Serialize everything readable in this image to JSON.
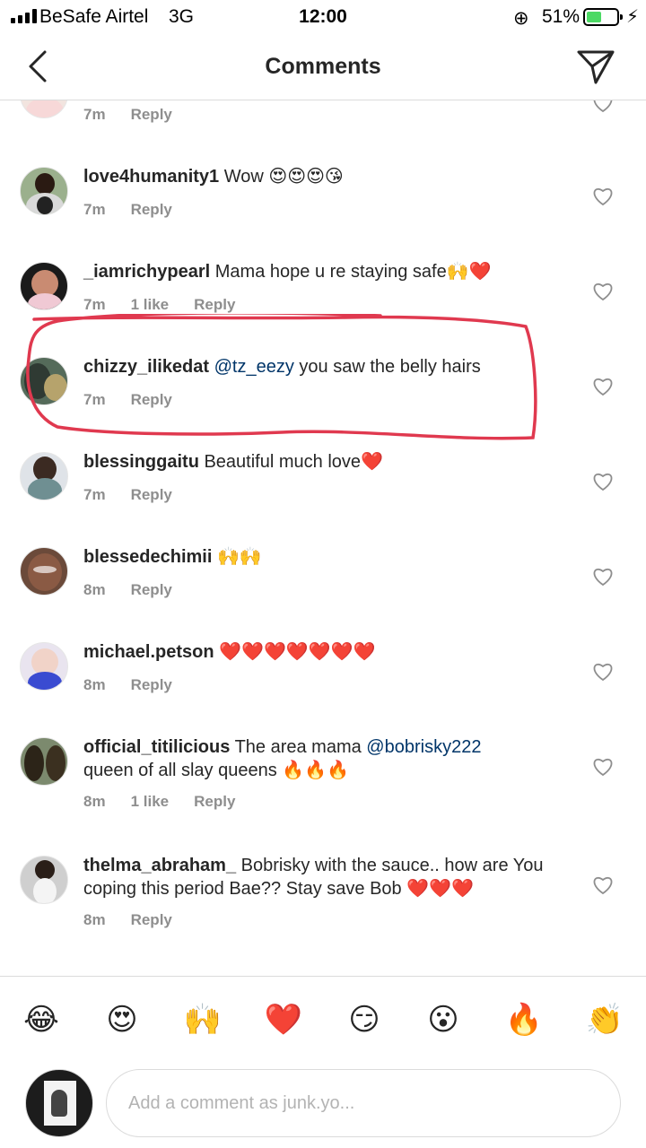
{
  "status_bar": {
    "carrier": "BeSafe Airtel",
    "network": "3G",
    "time": "12:00",
    "battery_percent": "51%",
    "battery_level": 0.51,
    "rotation_lock_icon": "⊕",
    "charging_icon": "⚡"
  },
  "header": {
    "title": "Comments",
    "back_icon": "chevron-left",
    "send_icon": "paper-plane"
  },
  "comments": [
    {
      "username": "",
      "text": "",
      "time": "7m",
      "likes": "",
      "reply": "Reply"
    },
    {
      "username": "love4humanity1",
      "text": "Wow 😍😍😍😘",
      "time": "7m",
      "likes": "",
      "reply": "Reply"
    },
    {
      "username": "_iamrichypearl",
      "text": "Mama hope u re staying safe🙌❤️",
      "time": "7m",
      "likes": "1 like",
      "reply": "Reply"
    },
    {
      "username": "chizzy_ilikedat",
      "mention": "@tz_eezy",
      "text": "you saw the belly hairs",
      "time": "7m",
      "likes": "",
      "reply": "Reply"
    },
    {
      "username": "blessinggaitu",
      "text": "Beautiful much love❤️",
      "time": "7m",
      "likes": "",
      "reply": "Reply"
    },
    {
      "username": "blessedechimii",
      "text": "🙌🙌",
      "time": "8m",
      "likes": "",
      "reply": "Reply"
    },
    {
      "username": "michael.petson",
      "text": "❤️❤️❤️❤️❤️❤️❤️",
      "time": "8m",
      "likes": "",
      "reply": "Reply"
    },
    {
      "username": "official_titilicious",
      "text": "The area mama",
      "mention": "@bobrisky222",
      "text2": "queen of all slay queens 🔥🔥🔥",
      "time": "8m",
      "likes": "1 like",
      "reply": "Reply"
    },
    {
      "username": "thelma_abraham_",
      "text": "Bobrisky with the sauce.. how are You coping this period Bae?? Stay save Bob ❤️❤️❤️",
      "time": "8m",
      "likes": "",
      "reply": "Reply"
    }
  ],
  "emoji_bar": [
    "😂",
    "😍",
    "🙌",
    "❤️",
    "😏",
    "😮",
    "🔥",
    "👏"
  ],
  "composer": {
    "placeholder": "Add a comment as junk.yo..."
  },
  "colors": {
    "text": "#262626",
    "meta": "#8e8e8e",
    "mention": "#003569",
    "highlight": "#e0394f",
    "divider": "#dbdbdb",
    "battery": "#4cd964"
  }
}
